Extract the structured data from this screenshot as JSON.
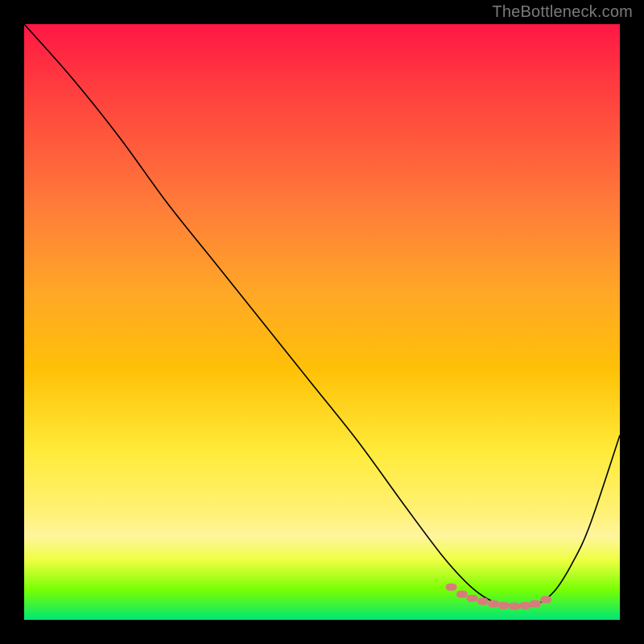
{
  "attribution": "TheBottleneck.com",
  "chart_data": {
    "type": "line",
    "title": "",
    "xlabel": "",
    "ylabel": "",
    "xlim": [
      0,
      100
    ],
    "ylim": [
      0,
      100
    ],
    "series": [
      {
        "name": "curve",
        "x": [
          0,
          8,
          16,
          24,
          32,
          40,
          48,
          56,
          64,
          70,
          74,
          77,
          80,
          83,
          86,
          89,
          92,
          95,
          100
        ],
        "values": [
          100,
          91,
          81,
          70,
          60,
          50,
          40,
          30,
          19,
          11,
          6.5,
          4.0,
          2.6,
          2.2,
          2.6,
          4.8,
          9.5,
          16,
          31
        ]
      }
    ],
    "markers": {
      "name": "bottom-cluster",
      "approx": true,
      "points": [
        [
          71.7,
          5.5
        ],
        [
          73.5,
          4.3
        ],
        [
          75.2,
          3.6
        ],
        [
          77.0,
          3.1
        ],
        [
          78.8,
          2.7
        ],
        [
          80.5,
          2.4
        ],
        [
          82.3,
          2.3
        ],
        [
          84.1,
          2.4
        ],
        [
          85.8,
          2.7
        ],
        [
          87.6,
          3.4
        ]
      ]
    }
  }
}
